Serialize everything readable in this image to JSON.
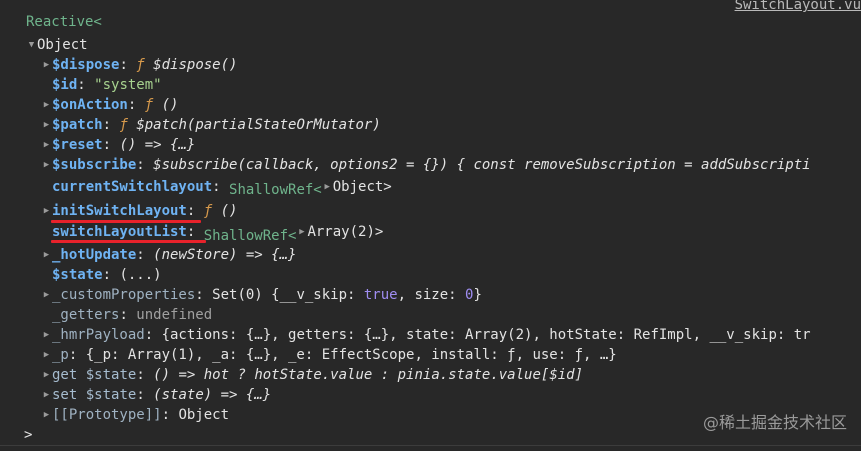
{
  "source_link": "SwitchLayout.vu",
  "reactive_label": "Reactive<",
  "object_label": "Object",
  "rows": {
    "dispose": {
      "key": "$dispose",
      "f": "ƒ",
      "rest": "$dispose()"
    },
    "id": {
      "key": "$id",
      "value": "\"system\""
    },
    "onAction": {
      "key": "$onAction",
      "f": "ƒ",
      "rest": "()"
    },
    "patch": {
      "key": "$patch",
      "f": "ƒ",
      "rest": "$patch(partialStateOrMutator)"
    },
    "reset": {
      "key": "$reset",
      "rest": "() => {…}"
    },
    "subscribe": {
      "key": "$subscribe",
      "rest": "$subscribe(callback, options2 = {}) { const removeSubscription = addSubscripti"
    },
    "currentSwitchlayout": {
      "key": "currentSwitchlayout",
      "ref": "ShallowRef<",
      "value": "Object>"
    },
    "initSwitchLayout": {
      "key": "initSwitchLayout",
      "f": "ƒ",
      "rest": "()"
    },
    "switchLayoutList": {
      "key": "switchLayoutList",
      "ref": "ShallowRef<",
      "value": "Array(2)>"
    },
    "hotUpdate": {
      "key": "_hotUpdate",
      "rest": "(newStore) => {…}"
    },
    "state": {
      "key": "$state",
      "rest": "(...)"
    },
    "customProperties": {
      "key": "_customProperties",
      "pre": "Set(0) {__v_skip: ",
      "bool": "true",
      "mid": ", size: ",
      "num": "0",
      "post": "}"
    },
    "getters": {
      "key": "_getters",
      "value": "undefined"
    },
    "hmrPayload": {
      "key": "_hmrPayload",
      "rest": "{actions: {…}, getters: {…}, state: Array(2), hotState: RefImpl, __v_skip: tr"
    },
    "p": {
      "key": "_p",
      "rest": "{_p: Array(1), _a: {…}, _e: EffectScope, install: ƒ, use: ƒ, …}"
    },
    "getState": {
      "prefix": "get",
      "key": "$state",
      "rest": "() => hot ? hotState.value : pinia.state.value[$id]"
    },
    "setState": {
      "prefix": "set",
      "key": "$state",
      "rest": "(state) => {…}"
    },
    "prototype": {
      "key": "[[Prototype]]",
      "value": "Object"
    }
  },
  "prompt": ">",
  "watermark": "@稀土掘金技术社区",
  "colors": {
    "background": "#282828",
    "highlight": "#e8222b",
    "key": "#6fb3f3"
  }
}
